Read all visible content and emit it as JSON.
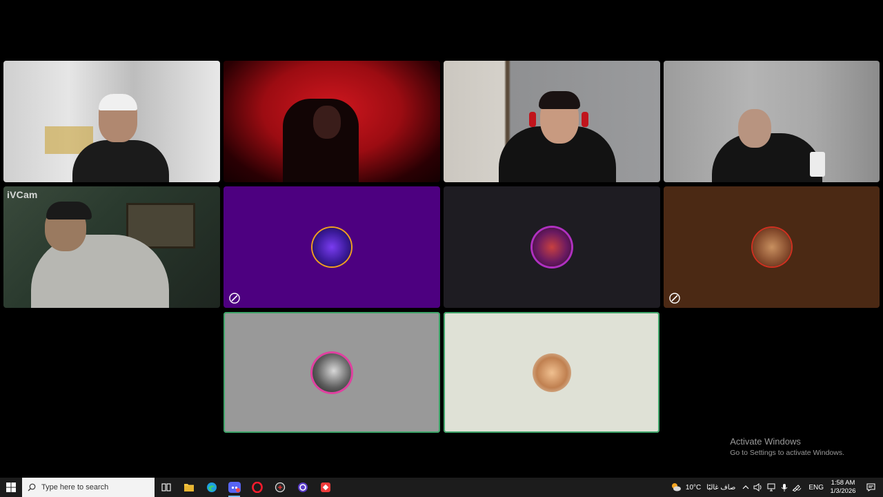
{
  "meeting": {
    "tiles": [
      {
        "id": "p1",
        "type": "video",
        "label": ""
      },
      {
        "id": "p2",
        "type": "video",
        "label": ""
      },
      {
        "id": "p3",
        "type": "video",
        "label": ""
      },
      {
        "id": "p4",
        "type": "video",
        "label": ""
      },
      {
        "id": "p5",
        "type": "video",
        "overlay_text": "iVCam"
      },
      {
        "id": "p6",
        "type": "avatar",
        "bg": "#4d0080",
        "muted": true
      },
      {
        "id": "p7",
        "type": "avatar",
        "bg": "#1e1c22",
        "muted": false
      },
      {
        "id": "p8",
        "type": "avatar",
        "bg": "#4b2914",
        "muted": true
      },
      {
        "id": "p9",
        "type": "avatar",
        "bg": "#999999",
        "speaking": true
      },
      {
        "id": "p10",
        "type": "avatar",
        "bg": "#dfe1d6",
        "speaking": true
      }
    ],
    "speaking_color": "#3fa66a"
  },
  "watermark": {
    "title": "Activate Windows",
    "subtitle": "Go to Settings to activate Windows."
  },
  "taskbar": {
    "search_placeholder": "Type here to search",
    "apps": [
      "task-view",
      "file-explorer",
      "edge",
      "discord",
      "opera",
      "app-circle",
      "cortana-like",
      "anydesk-like"
    ],
    "weather": "10°C",
    "weather_desc": "صاف غالبًا",
    "language": "ENG",
    "time": "1:58 AM",
    "date": "1/3/2026"
  }
}
